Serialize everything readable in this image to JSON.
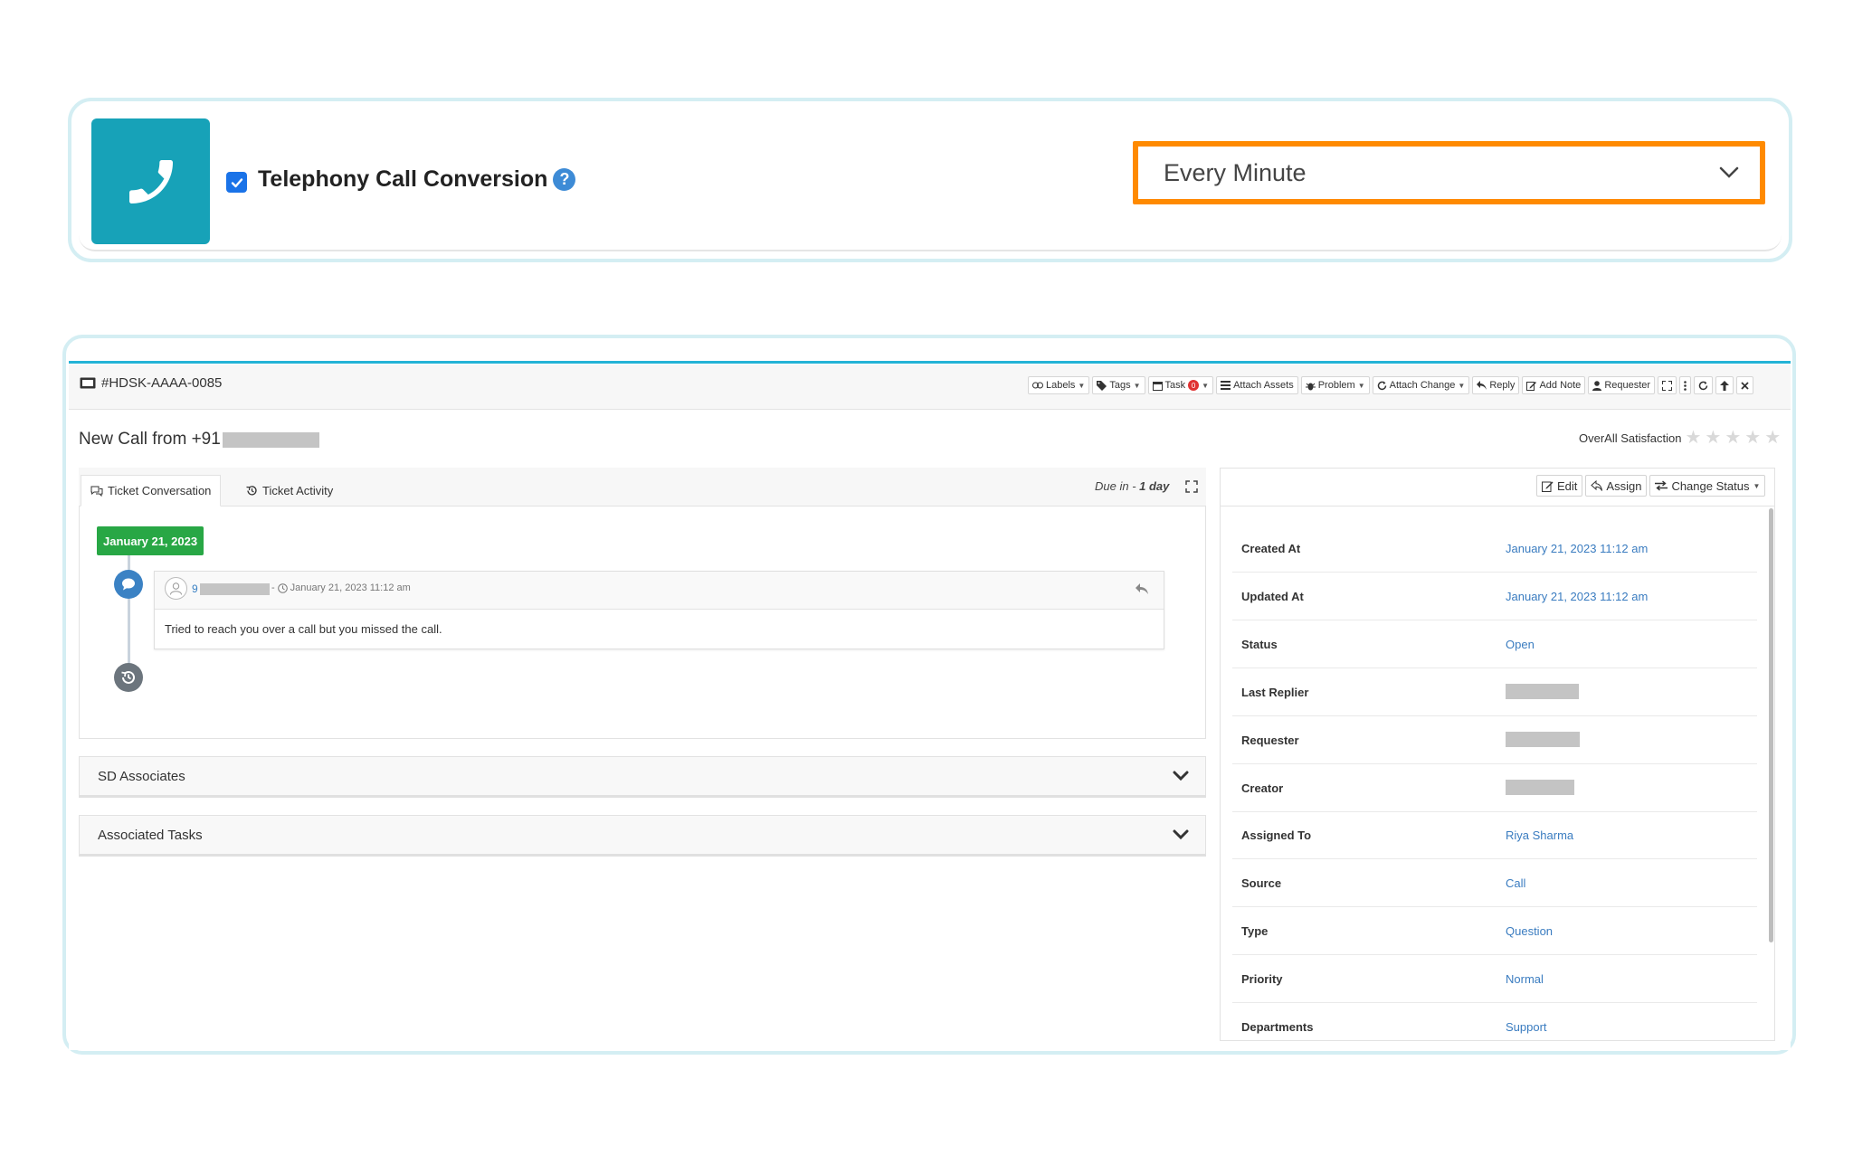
{
  "top": {
    "title": "Telephony Call Conversion",
    "help_glyph": "?",
    "frequency_value": "Every Minute"
  },
  "ticket": {
    "id": "#HDSK-AAAA-0085",
    "title_prefix": "New Call from +91",
    "toolbar": {
      "labels": "Labels",
      "tags": "Tags",
      "task": "Task",
      "task_count": "0",
      "attach_assets": "Attach Assets",
      "problem": "Problem",
      "attach_change": "Attach Change",
      "reply": "Reply",
      "add_note": "Add Note",
      "requester": "Requester"
    },
    "satisfaction_label": "OverAll Satisfaction",
    "tabs": {
      "conversation": "Ticket Conversation",
      "activity": "Ticket Activity"
    },
    "due_prefix": "Due in - ",
    "due_value": "1 day",
    "timeline": {
      "date": "January 21, 2023",
      "author_prefix": "9",
      "timestamp": "January 21, 2023 11:12 am",
      "message": "Tried to reach you over a call but you missed the call."
    },
    "accordions": {
      "sd_associates": "SD Associates",
      "associated_tasks": "Associated Tasks"
    },
    "details_actions": {
      "edit": "Edit",
      "assign": "Assign",
      "change_status": "Change Status"
    },
    "details": {
      "created_at": {
        "label": "Created At",
        "value": "January 21, 2023 11:12 am"
      },
      "updated_at": {
        "label": "Updated At",
        "value": "January 21, 2023 11:12 am"
      },
      "status": {
        "label": "Status",
        "value": "Open"
      },
      "last_replier": {
        "label": "Last Replier"
      },
      "requester": {
        "label": "Requester"
      },
      "creator": {
        "label": "Creator"
      },
      "assigned_to": {
        "label": "Assigned To",
        "value": "Riya Sharma"
      },
      "source": {
        "label": "Source",
        "value": "Call"
      },
      "type": {
        "label": "Type",
        "value": "Question"
      },
      "priority": {
        "label": "Priority",
        "value": "Normal"
      },
      "departments": {
        "label": "Departments",
        "value": "Support"
      }
    }
  },
  "colors": {
    "accent_teal": "#17a2b8",
    "highlight_orange": "#ff8a00",
    "date_green": "#28a745",
    "link_blue": "#3a7cc0"
  },
  "icons": [
    "phone-icon",
    "check-icon",
    "help-icon",
    "chevron-down-icon",
    "ticket-icon",
    "star-icon",
    "chat-icon",
    "history-icon",
    "reply-icon",
    "expand-icon",
    "refresh-icon",
    "close-icon"
  ]
}
